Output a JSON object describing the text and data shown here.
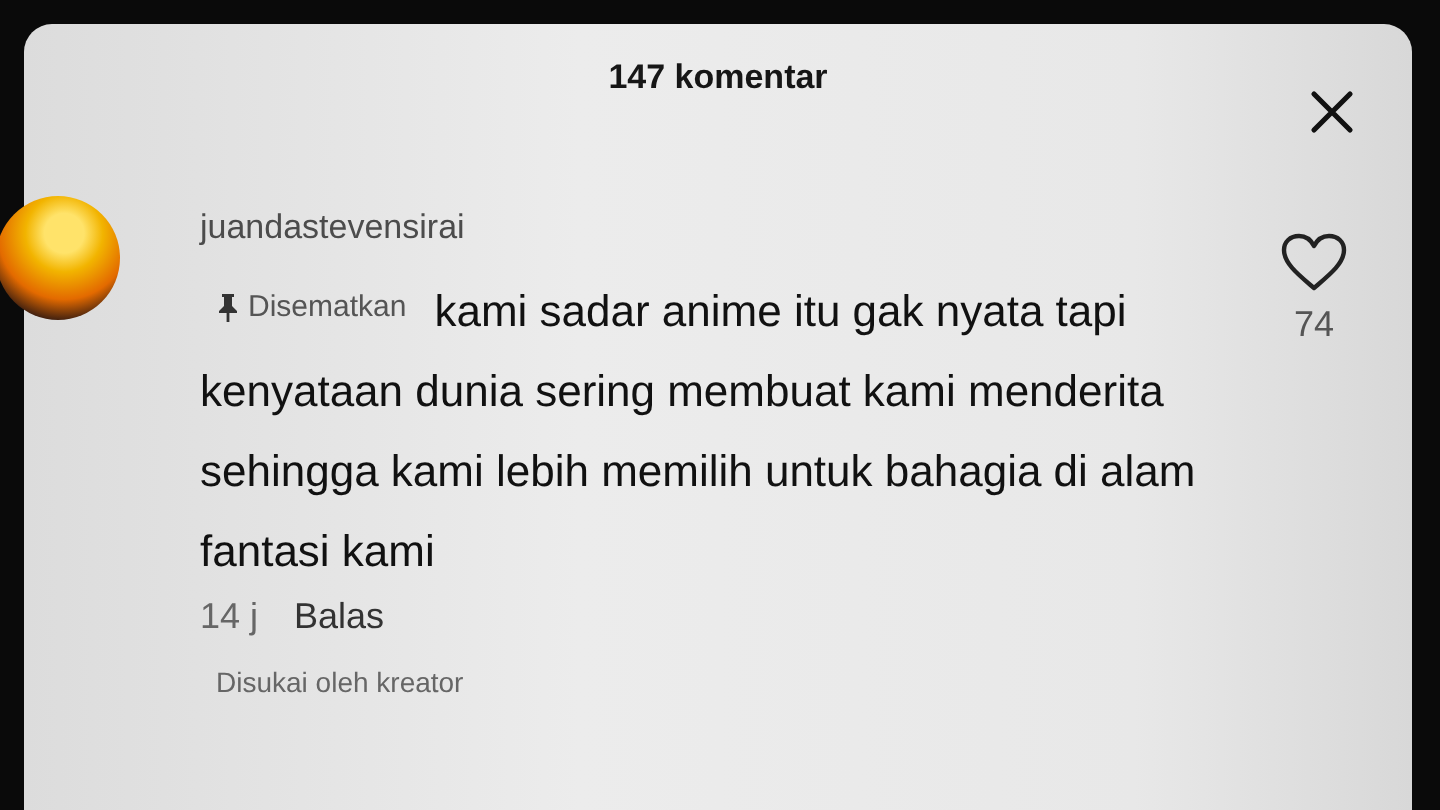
{
  "header": {
    "title": "147 komentar"
  },
  "comment": {
    "username": "juandastevensirai",
    "pinned_label": "Disematkan",
    "text": "kami sadar anime itu gak nyata tapi kenyataan dunia sering membuat kami menderita sehingga kami lebih memilih untuk bahagia di alam fantasi kami",
    "liked": false,
    "like_count": "74",
    "time": "14 j",
    "reply": "Balas",
    "creator_note": "Disukai oleh kreator"
  }
}
